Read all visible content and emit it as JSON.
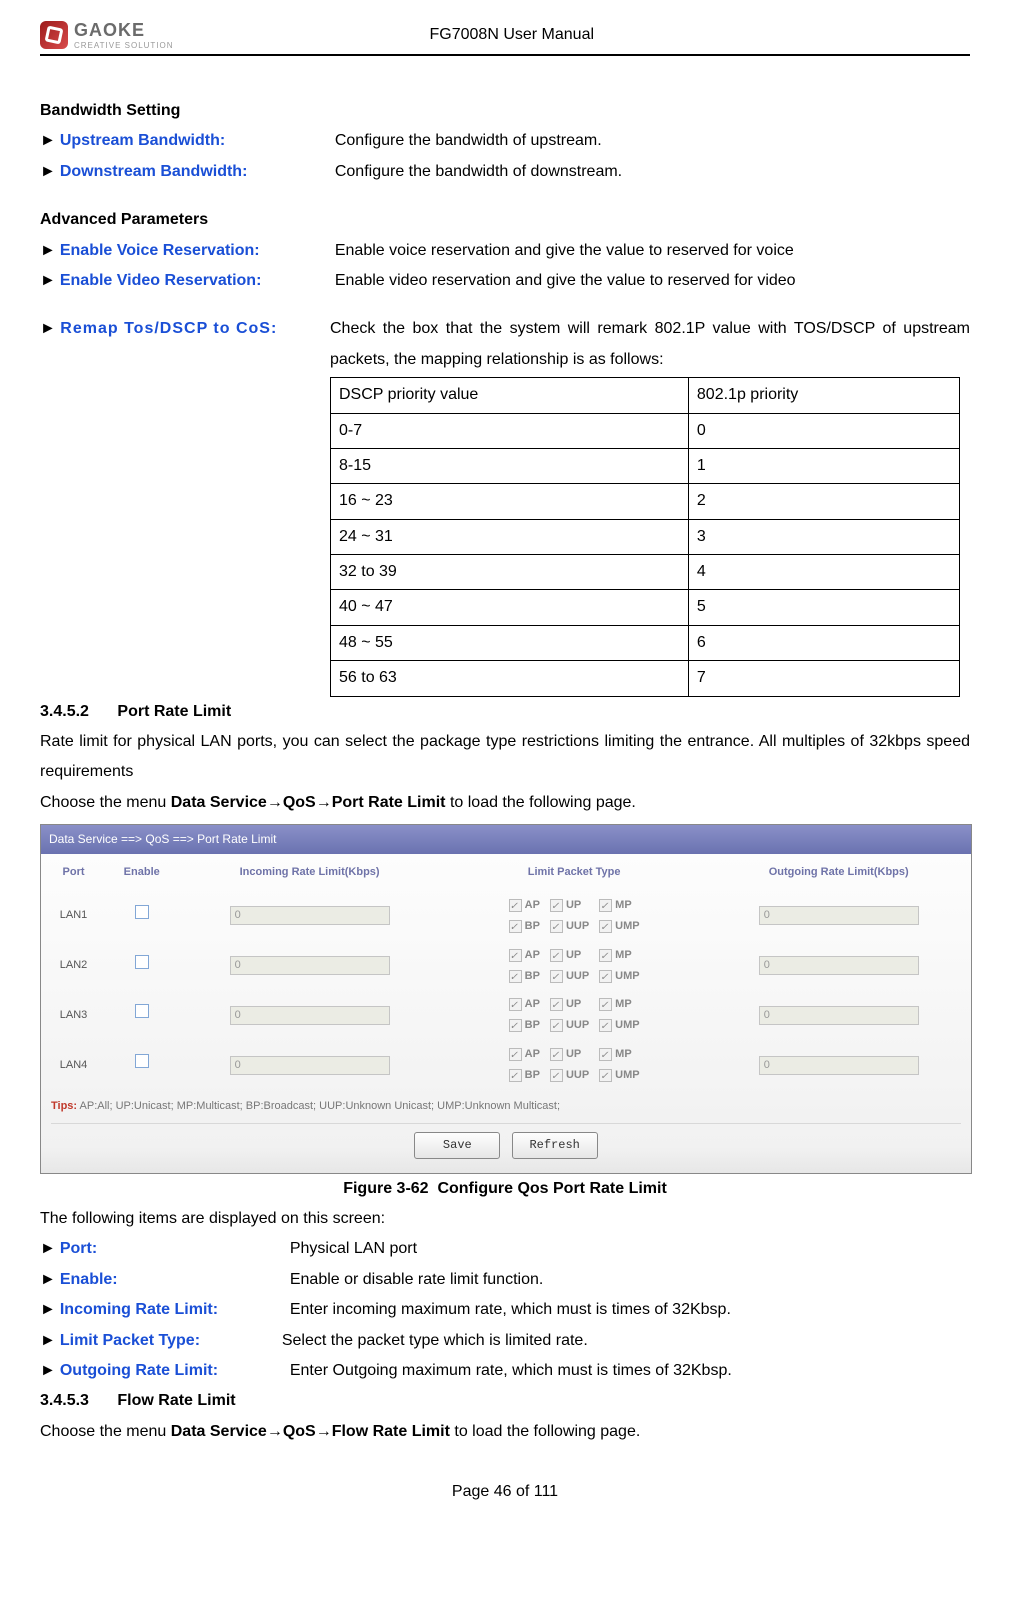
{
  "header": {
    "brand": "GAOKE",
    "tagline": "CREATIVE SOLUTION",
    "title": "FG7008N User Manual"
  },
  "bandwidth": {
    "heading": "Bandwidth Setting",
    "items": [
      {
        "term": "Upstream Bandwidth:",
        "desc": "Configure the bandwidth of upstream."
      },
      {
        "term": "Downstream Bandwidth:",
        "desc": "Configure the bandwidth of downstream."
      }
    ]
  },
  "advanced": {
    "heading": "Advanced Parameters",
    "items": [
      {
        "term": "Enable Voice Reservation:",
        "desc": "Enable voice reservation and give the value to reserved for voice"
      },
      {
        "term": "Enable Video Reservation:",
        "desc": "Enable video reservation and give the value to reserved for video"
      }
    ],
    "remap": {
      "term": "Remap Tos/DSCP to CoS:",
      "desc": "Check the box that the system will remark 802.1P value with TOS/DSCP of upstream packets, the mapping relationship is as follows:"
    }
  },
  "priority_table": {
    "header": [
      "DSCP priority value",
      "802.1p priority"
    ],
    "rows": [
      [
        "0-7",
        "0"
      ],
      [
        "8-15",
        "1"
      ],
      [
        "16 ~ 23",
        "2"
      ],
      [
        "24 ~ 31",
        "3"
      ],
      [
        "32 to 39",
        "4"
      ],
      [
        "40 ~ 47",
        "5"
      ],
      [
        "48 ~ 55",
        "6"
      ],
      [
        "56 to 63",
        "7"
      ]
    ]
  },
  "section_3452": {
    "num": "3.4.5.2",
    "title": "Port Rate Limit",
    "para1": "Rate limit for physical LAN ports, you can select the package type restrictions limiting the entrance. All multiples of 32kbps speed requirements",
    "para2_pre": "Choose the menu ",
    "para2_path": "Data Service→QoS→Port Rate Limit",
    "para2_post": " to load the following page."
  },
  "screenshot": {
    "titlebar": "Data Service ==> QoS ==> Port Rate Limit",
    "columns": [
      "Port",
      "Enable",
      "Incoming Rate Limit(Kbps)",
      "Limit Packet Type",
      "Outgoing Rate Limit(Kbps)"
    ],
    "ports": [
      "LAN1",
      "LAN2",
      "LAN3",
      "LAN4"
    ],
    "rate_value": "0",
    "packet_types": [
      "AP",
      "UP",
      "MP",
      "BP",
      "UUP",
      "UMP"
    ],
    "tips_label": "Tips:",
    "tips_text": " AP:All; UP:Unicast; MP:Multicast; BP:Broadcast; UUP:Unknown Unicast; UMP:Unknown Multicast;",
    "buttons": {
      "save": "Save",
      "refresh": "Refresh"
    }
  },
  "figure": {
    "label": "Figure 3-62",
    "caption": "Configure Qos Port Rate Limit"
  },
  "items_displayed": {
    "intro": "The following items are displayed on this screen:",
    "list": [
      {
        "term": "Port:",
        "desc": "Physical LAN port"
      },
      {
        "term": "Enable:",
        "desc": "Enable or disable rate limit function."
      },
      {
        "term": "Incoming Rate Limit:",
        "desc": "Enter incoming maximum rate, which must is times of 32Kbsp."
      },
      {
        "term": "Limit Packet Type:",
        "desc": "Select the packet type which is limited rate."
      },
      {
        "term": "Outgoing Rate Limit:",
        "desc": "Enter Outgoing maximum rate, which must is times of 32Kbsp."
      }
    ]
  },
  "section_3453": {
    "num": "3.4.5.3",
    "title": "Flow Rate Limit",
    "para_pre": "Choose the menu ",
    "para_path": "Data Service→QoS→Flow Rate Limit",
    "para_post": " to load the following page."
  },
  "footer": {
    "page": "Page 46 of 111"
  }
}
